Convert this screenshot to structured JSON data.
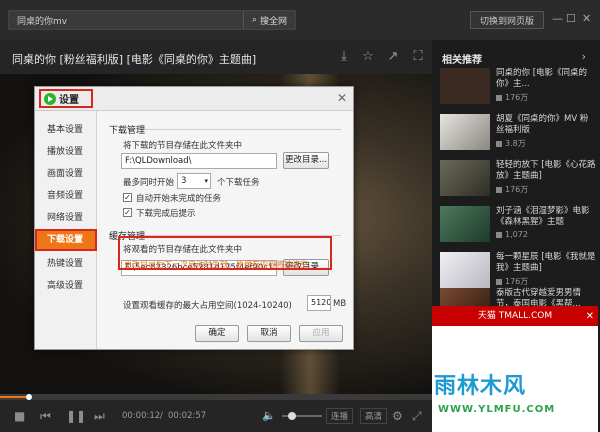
{
  "search": {
    "query": "同桌的你mv",
    "button_label": "搜全网"
  },
  "header": {
    "web_button": "切换到网页版"
  },
  "video": {
    "title": "同桌的你 [粉丝福利版] [电影《同桌的你》主题曲]"
  },
  "dialog": {
    "title": "设置",
    "sidebar": [
      "基本设置",
      "播放设置",
      "画面设置",
      "音频设置",
      "网络设置",
      "下载设置",
      "热键设置",
      "高级设置"
    ],
    "active_index": 5,
    "download": {
      "section_title": "下载管理",
      "dir_label": "将下载的节目存储在此文件夹中",
      "dir_value": "F:\\QLDownload\\",
      "change_btn": "更改目录...",
      "concurrent_prefix": "最多同时开始",
      "concurrent_value": "3",
      "concurrent_suffix": "个下载任务",
      "auto_resume": "自动开始未完成的任务",
      "finish_prompt": "下载完成后提示"
    },
    "cache": {
      "section_title": "缓存管理",
      "dir_label": "将观看的节目存储在此文件夹中",
      "dir_value": "F:\\5ec82326bce5281d175f4ef90c111212\\",
      "change_btn": "更改目录...",
      "warning": "更改目录后下一次启动时生效，原缓存内容将被清空",
      "max_label": "设置观看缓存的最大占用空间(1024-10240)",
      "max_value": "5120",
      "max_unit": "MB"
    },
    "buttons": {
      "ok": "确定",
      "cancel": "取消",
      "apply": "应用"
    }
  },
  "player": {
    "current_time": "00:00:12",
    "total_time": "00:02:57",
    "progress": 0.068,
    "volume": 0.25,
    "mode_btn": "连播",
    "quality_btn": "高清"
  },
  "recommend": {
    "title": "相关推荐",
    "items": [
      {
        "title": "同桌的你 [电影《同桌的你》主...",
        "plays": "176万",
        "thumb": "#3a2a22"
      },
      {
        "title": "胡夏《同桌的你》MV 粉丝福利版",
        "plays": "3.8万",
        "thumb": "#8a8680"
      },
      {
        "title": "轻轻的放下 [电影《心花路放》主题曲]",
        "plays": "176万",
        "thumb": "#4a4a40"
      },
      {
        "title": "刘子涵《泪湿梦影》电影《森林黑猩》主题",
        "plays": "1,072",
        "thumb": "#2e4a3a"
      },
      {
        "title": "每一颗星辰 [电影《我就是我》主题曲]",
        "plays": "176万",
        "thumb": "#d8d8dc"
      },
      {
        "title": "泰版古代穿越爱男男情节，泰国电影《黑帮...",
        "plays": "",
        "thumb": "#5a3a2a"
      }
    ]
  },
  "ad": {
    "header": "天猫 TMALL.COM",
    "watermark": "雨林木风",
    "watermark_url": "WWW.YLMFU.COM"
  }
}
